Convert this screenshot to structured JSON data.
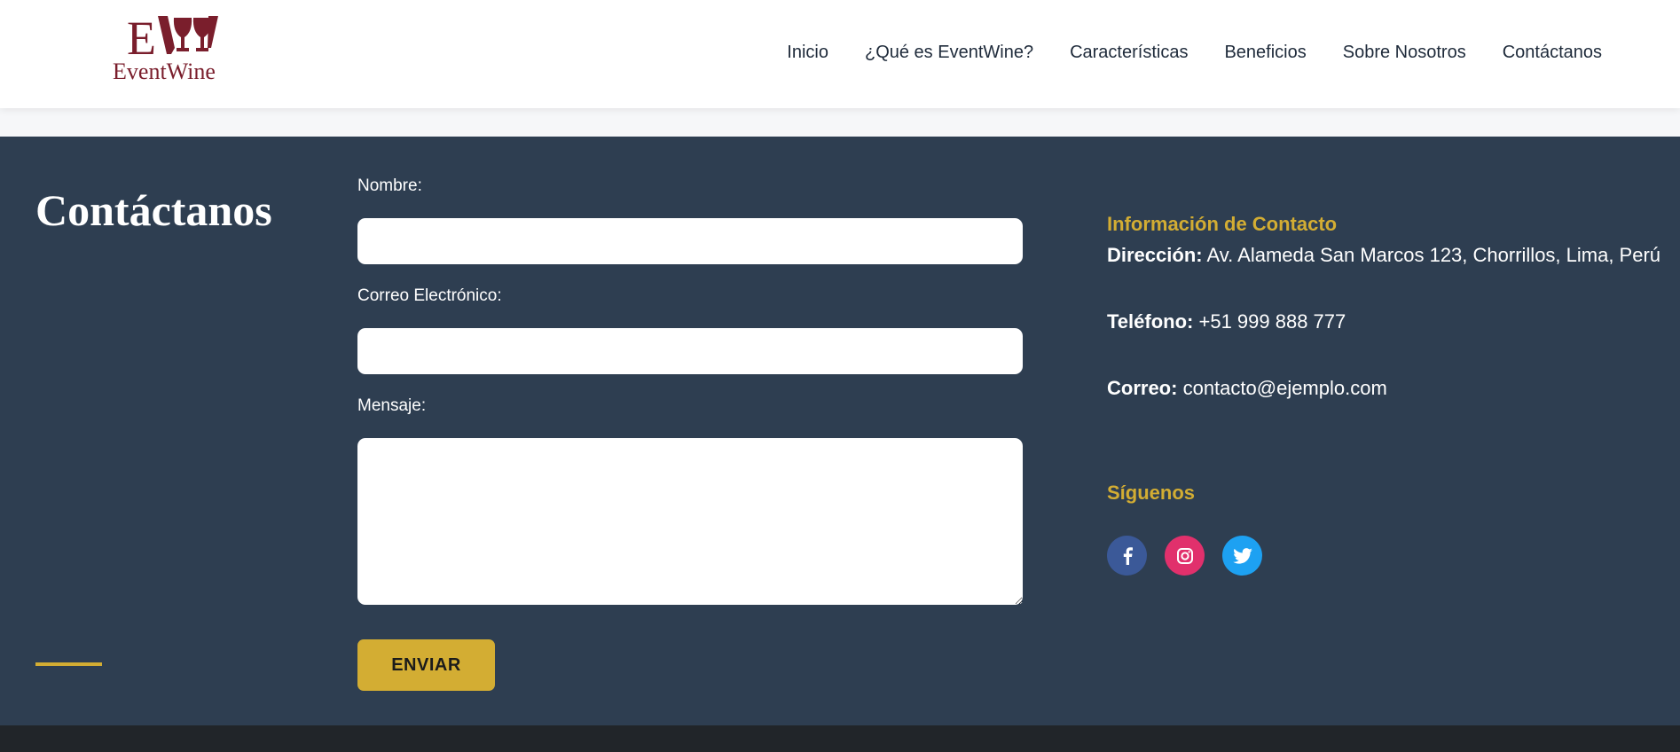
{
  "header": {
    "logo_text": "EventWine",
    "brand_color": "#7a1e2c",
    "nav": [
      {
        "label": "Inicio"
      },
      {
        "label": "¿Qué es EventWine?"
      },
      {
        "label": "Características"
      },
      {
        "label": "Beneficios"
      },
      {
        "label": "Sobre Nosotros"
      },
      {
        "label": "Contáctanos"
      }
    ]
  },
  "contact": {
    "title": "Contáctanos",
    "accent_color": "#d3ad33",
    "background_color": "#2e3e51",
    "form": {
      "name_label": "Nombre:",
      "name_value": "",
      "email_label": "Correo Electrónico:",
      "email_value": "",
      "message_label": "Mensaje:",
      "message_value": "",
      "submit_label": "ENVIAR"
    },
    "info": {
      "heading": "Información de Contacto",
      "address_label": "Dirección:",
      "address_value": "Av. Alameda San Marcos 123, Chorrillos, Lima, Perú",
      "phone_label": "Teléfono:",
      "phone_value": "+51 999 888 777",
      "email_label": "Correo:",
      "email_value": "contacto@ejemplo.com"
    },
    "follow": {
      "heading": "Síguenos",
      "socials": [
        {
          "icon": "facebook-icon",
          "color": "#3b5998"
        },
        {
          "icon": "instagram-icon",
          "color": "#e1306c"
        },
        {
          "icon": "twitter-icon",
          "color": "#1da1f2"
        }
      ]
    }
  }
}
